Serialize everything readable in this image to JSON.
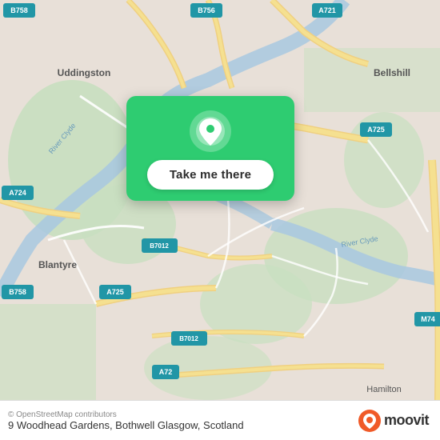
{
  "map": {
    "background_color": "#e8e0d8"
  },
  "card": {
    "button_label": "Take me there",
    "bg_color": "#2ecc71"
  },
  "footer": {
    "address": "9 Woodhead Gardens, Bothwell Glasgow, Scotland",
    "attribution": "© OpenStreetMap contributors",
    "brand": "moovit"
  }
}
